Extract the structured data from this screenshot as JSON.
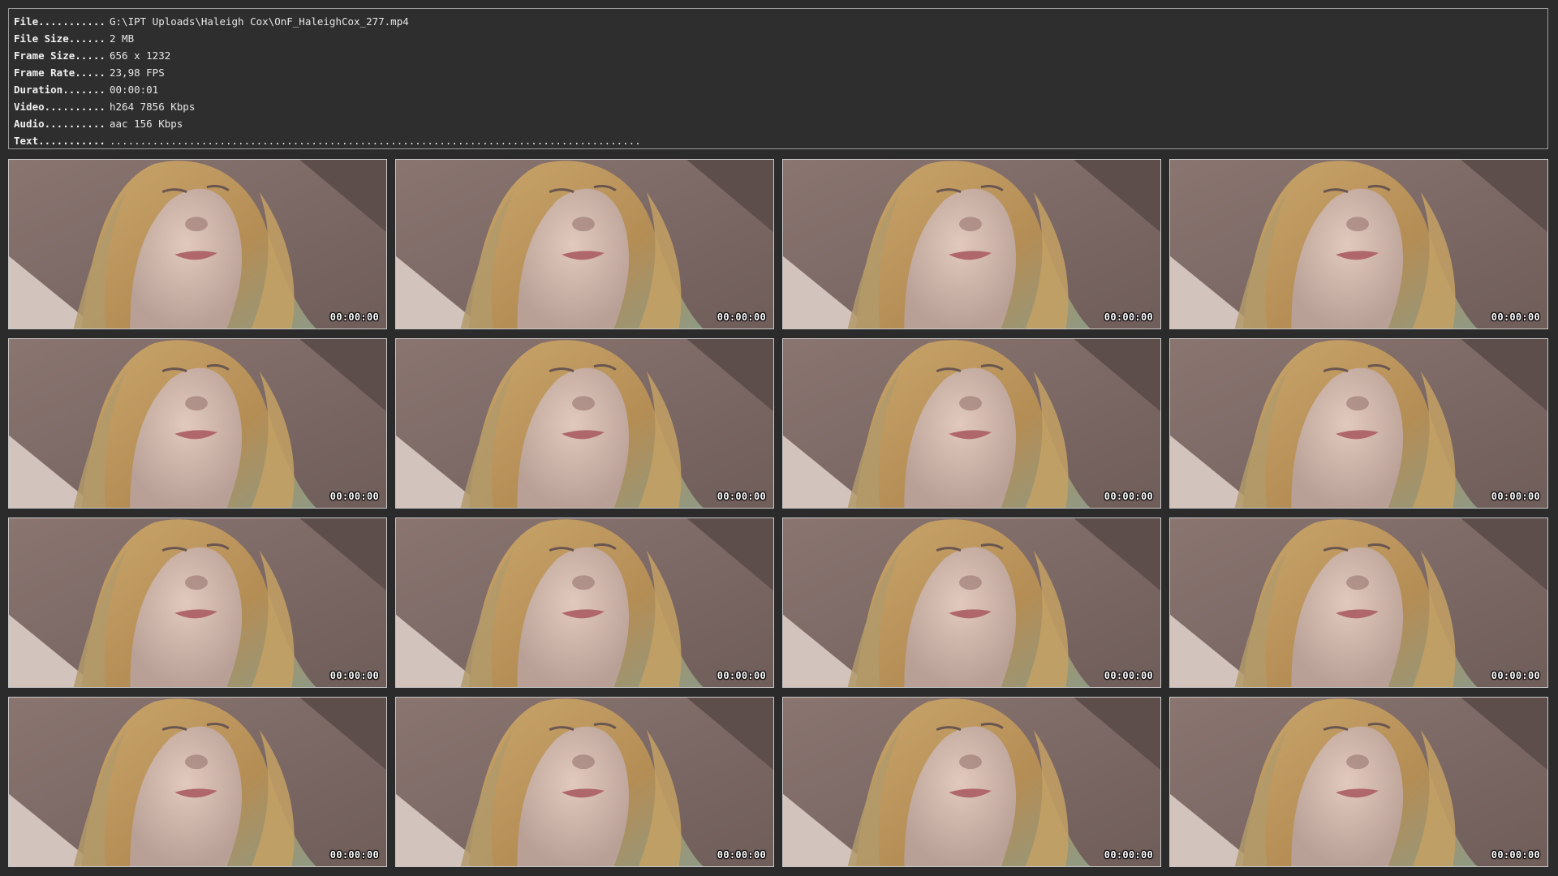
{
  "info": [
    {
      "key": "File...........",
      "value": "G:\\IPT Uploads\\Haleigh Cox\\OnF_HaleighCox_277.mp4"
    },
    {
      "key": "File Size......",
      "value": "2 MB"
    },
    {
      "key": "Frame Size.....",
      "value": "656 x 1232"
    },
    {
      "key": "Frame Rate.....",
      "value": "23,98 FPS"
    },
    {
      "key": "Duration.......",
      "value": "00:00:01"
    },
    {
      "key": "Video..........",
      "value": "h264 7856 Kbps"
    },
    {
      "key": "Audio..........",
      "value": "aac 156 Kbps"
    },
    {
      "key": "Text...........",
      "value": "......................................................................................."
    }
  ],
  "thumbnails": [
    {
      "timecode": "00:00:00"
    },
    {
      "timecode": "00:00:00"
    },
    {
      "timecode": "00:00:00"
    },
    {
      "timecode": "00:00:00"
    },
    {
      "timecode": "00:00:00"
    },
    {
      "timecode": "00:00:00"
    },
    {
      "timecode": "00:00:00"
    },
    {
      "timecode": "00:00:00"
    },
    {
      "timecode": "00:00:00"
    },
    {
      "timecode": "00:00:00"
    },
    {
      "timecode": "00:00:00"
    },
    {
      "timecode": "00:00:00"
    },
    {
      "timecode": "00:00:00"
    },
    {
      "timecode": "00:00:00"
    },
    {
      "timecode": "00:00:00"
    },
    {
      "timecode": "00:00:00"
    }
  ],
  "colors": {
    "background": "#2b2b2b",
    "panel_border": "#9a9a9a",
    "thumb_border": "#c8c8c8",
    "text": "#e6e6e6"
  }
}
